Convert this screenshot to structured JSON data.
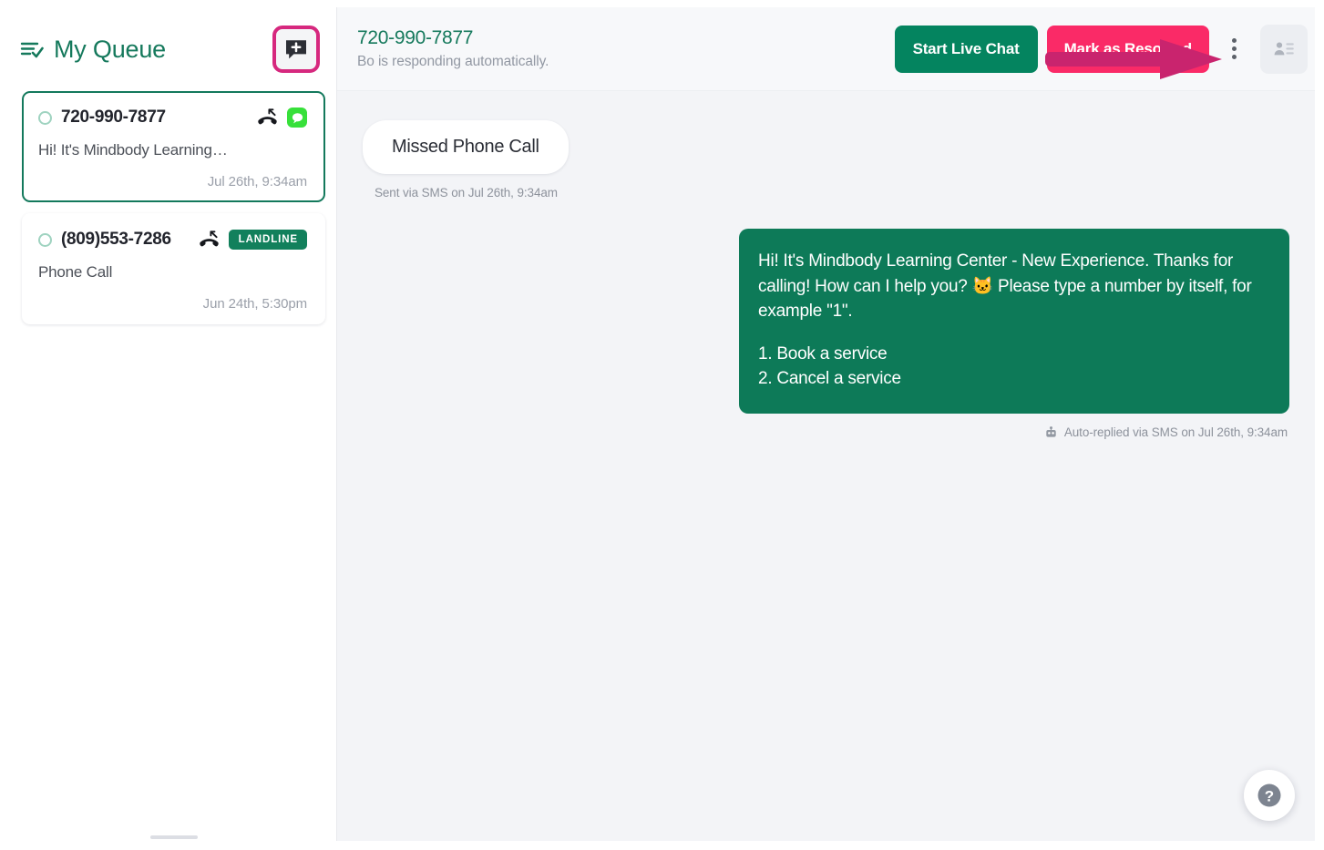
{
  "sidebar": {
    "title": "My Queue",
    "list_icon": "list-check-icon",
    "new_message_icon": "new-message-bubble-icon",
    "cards": [
      {
        "number": "720-990-7877",
        "preview": "Hi! It's Mindbody Learning…",
        "time": "Jul 26th, 9:34am",
        "selected": true,
        "missed_call_icon": "missed-call-icon",
        "channel_icon": "sms-bubble-icon",
        "badge": ""
      },
      {
        "number": "(809)553-7286",
        "preview": "Phone Call",
        "time": "Jun 24th, 5:30pm",
        "selected": false,
        "missed_call_icon": "missed-call-icon",
        "channel_icon": "",
        "badge": "LANDLINE"
      }
    ]
  },
  "header": {
    "conversation_number": "720-990-7877",
    "subtitle": "Bo is responding automatically.",
    "start_live_chat_label": "Start Live Chat",
    "mark_resolved_label": "Mark as Resolved",
    "kebab_icon": "more-options-icon",
    "contact_icon": "contact-details-icon"
  },
  "annotation": {
    "arrow_icon": "pointer-arrow-icon",
    "arrow_color": "#c9246e",
    "points_to": "Start Live Chat"
  },
  "conversation": {
    "messages": [
      {
        "direction": "inbound",
        "text": "Missed Phone Call",
        "meta": "Sent via SMS on Jul 26th, 9:34am",
        "meta_icon": ""
      },
      {
        "direction": "outbound",
        "paragraph": "Hi! It's Mindbody Learning Center - New Experience. Thanks for calling! How can I help you? 🐱 Please type a number by itself, for example \"1\".",
        "options": [
          "1. Book a service",
          "2. Cancel a service"
        ],
        "meta": "Auto-replied via SMS on Jul 26th, 9:34am",
        "meta_icon": "robot-icon"
      }
    ]
  },
  "help": {
    "icon": "question-mark-icon"
  },
  "colors": {
    "brand_green": "#15795c",
    "button_green": "#04845f",
    "bubble_green": "#0d7a58",
    "pink": "#fa2a67",
    "magenta_border": "#d6287e",
    "annotation_magenta": "#c9246e",
    "landline_green": "#12805c",
    "sms_green": "#37e03a",
    "main_bg": "#f3f4f7"
  }
}
